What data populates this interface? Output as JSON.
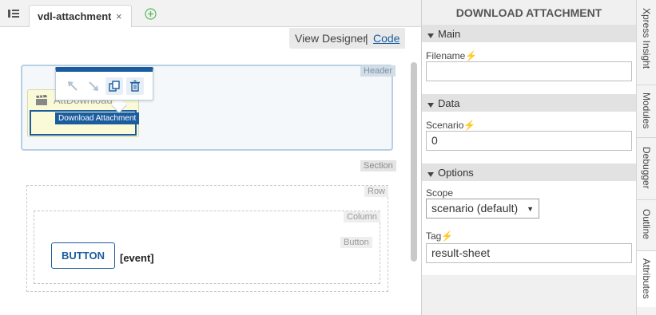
{
  "tabs": [
    {
      "label": "vdl-attachment-",
      "close": "×"
    }
  ],
  "view_switch": {
    "designer": "View Designer",
    "separator": "|",
    "code": "Code"
  },
  "canvas": {
    "labels": {
      "header": "Header",
      "section": "Section",
      "row": "Row",
      "column": "Column",
      "button": "Button"
    },
    "component": {
      "name": "AttDownload",
      "tag": "Download Attachment"
    },
    "button_text": "BUTTON",
    "button_event": "[event]"
  },
  "panel": {
    "title": "DOWNLOAD ATTACHMENT",
    "groups": {
      "main": "Main",
      "data": "Data",
      "options": "Options"
    },
    "props": {
      "filename": {
        "label": "Filename",
        "value": ""
      },
      "scenario": {
        "label": "Scenario",
        "value": "0"
      },
      "scope": {
        "label": "Scope",
        "value": "scenario (default)"
      },
      "tag": {
        "label": "Tag",
        "value": "result-sheet"
      }
    },
    "bolt": "⚡",
    "caret": "▼",
    "group_arrow": "▼"
  },
  "side_tabs": [
    "Xpress Insight",
    "Modules",
    "Debugger",
    "Outline",
    "Attributes"
  ],
  "colors": {
    "accent": "#1a5c9e",
    "bolt": "#f0a500",
    "component_bg": "#fafad8"
  }
}
